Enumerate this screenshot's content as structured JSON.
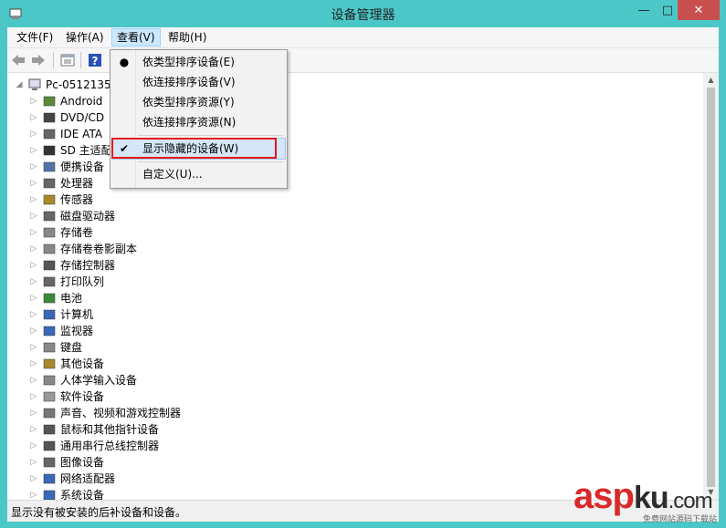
{
  "window": {
    "title": "设备管理器",
    "minimize": "—",
    "maximize": "□",
    "close": "✕"
  },
  "menubar": [
    {
      "label": "文件(F)",
      "active": false
    },
    {
      "label": "操作(A)",
      "active": false
    },
    {
      "label": "查看(V)",
      "active": true
    },
    {
      "label": "帮助(H)",
      "active": false
    }
  ],
  "toolbar": {
    "icons": [
      "back-arrow-icon",
      "forward-arrow-icon",
      "properties-icon",
      "help-icon"
    ]
  },
  "tree": {
    "root": "Pc-0512135",
    "items": [
      {
        "label": "Android"
      },
      {
        "label": "DVD/CD"
      },
      {
        "label": "IDE ATA"
      },
      {
        "label": "SD 主适配"
      },
      {
        "label": "便携设备"
      },
      {
        "label": "处理器"
      },
      {
        "label": "传感器"
      },
      {
        "label": "磁盘驱动器"
      },
      {
        "label": "存储卷"
      },
      {
        "label": "存储卷卷影副本"
      },
      {
        "label": "存储控制器"
      },
      {
        "label": "打印队列"
      },
      {
        "label": "电池"
      },
      {
        "label": "计算机"
      },
      {
        "label": "监视器"
      },
      {
        "label": "键盘"
      },
      {
        "label": "其他设备"
      },
      {
        "label": "人体学输入设备"
      },
      {
        "label": "软件设备"
      },
      {
        "label": "声音、视频和游戏控制器"
      },
      {
        "label": "鼠标和其他指针设备"
      },
      {
        "label": "通用串行总线控制器"
      },
      {
        "label": "图像设备"
      },
      {
        "label": "网络适配器"
      },
      {
        "label": "系统设备"
      }
    ]
  },
  "view_menu": {
    "items": [
      {
        "label": "依类型排序设备(E)",
        "mark": "●"
      },
      {
        "label": "依连接排序设备(V)",
        "mark": ""
      },
      {
        "label": "依类型排序资源(Y)",
        "mark": ""
      },
      {
        "label": "依连接排序资源(N)",
        "mark": ""
      },
      {
        "label": "显示隐藏的设备(W)",
        "mark": "✔"
      },
      {
        "label": "自定义(U)...",
        "mark": ""
      }
    ]
  },
  "status": {
    "text": "显示没有被安装的后补设备和设备。"
  },
  "watermark": {
    "asp": "asp",
    "ku": "ku",
    "com": ".com",
    "sub": "免费网站源码下载站"
  },
  "colors": {
    "window_frame": "#4cc7c8",
    "close_button": "#c7504f",
    "highlight": "#e4161c"
  }
}
